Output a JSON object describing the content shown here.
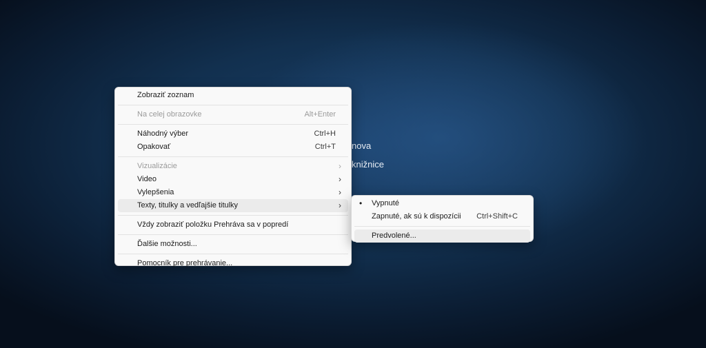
{
  "background": {
    "fragment_1": "nova",
    "fragment_2": "knižnice"
  },
  "main_menu": {
    "show_list": "Zobraziť zoznam",
    "fullscreen": "Na celej obrazovke",
    "fullscreen_shortcut": "Alt+Enter",
    "shuffle": "Náhodný výber",
    "shuffle_shortcut": "Ctrl+H",
    "repeat": "Opakovať",
    "repeat_shortcut": "Ctrl+T",
    "visualizations": "Vizualizácie",
    "video": "Video",
    "enhancements": "Vylepšenia",
    "lyrics_subtitles": "Texty, titulky a vedľajšie titulky",
    "always_on_top": "Vždy zobraziť položku Prehráva sa v popredí",
    "more_options": "Ďalšie možnosti...",
    "playback_help": "Pomocník pre prehrávanie..."
  },
  "sub_menu": {
    "off": "Vypnuté",
    "off_selected": true,
    "on_if_available": "Zapnuté, ak sú k dispozícii",
    "on_shortcut": "Ctrl+Shift+C",
    "defaults": "Predvolené..."
  },
  "icons": {
    "chevron": "›",
    "bullet": "•"
  },
  "colors": {
    "menu_bg": "#f9f9f9",
    "hover_bg": "#ebebeb",
    "disabled_text": "#9a9a9a"
  }
}
